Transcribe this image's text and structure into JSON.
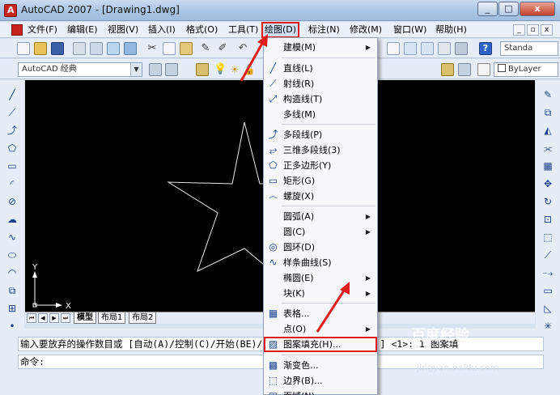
{
  "window": {
    "title": "AutoCAD 2007 - [Drawing1.dwg]",
    "minimize": "_",
    "maximize": "□",
    "close": "x"
  },
  "menubar": {
    "items": [
      "文件(F)",
      "编辑(E)",
      "视图(V)",
      "插入(I)",
      "格式(O)",
      "工具(T)",
      "绘图(D)",
      "标注(N)",
      "修改(M)",
      "窗口(W)",
      "帮助(H)"
    ],
    "active": "绘图(D)",
    "mdi_min": "_",
    "mdi_restore": "▫",
    "mdi_close": "x"
  },
  "toolbar": {
    "style_combo": "Standa",
    "workspace_combo": "AutoCAD 经典",
    "linetype_combo": "ByLayer"
  },
  "drawing": {
    "model_tab": "模型",
    "layout1_tab": "布局1",
    "layout2_tab": "布局2",
    "ucs_y": "Y",
    "ucs_x": "X"
  },
  "dropdown": {
    "items": [
      {
        "label": "建模(M)",
        "icon": "none",
        "submenu": true
      },
      {
        "label": "直线(L)",
        "icon": "line-icon",
        "submenu": false
      },
      {
        "label": "射线(R)",
        "icon": "ray-icon",
        "submenu": false
      },
      {
        "label": "构造线(T)",
        "icon": "xline-icon",
        "submenu": false
      },
      {
        "label": "多线(M)",
        "icon": "none",
        "submenu": false
      },
      {
        "label": "多段线(P)",
        "icon": "polyline-icon",
        "submenu": false
      },
      {
        "label": "三维多段线(3)",
        "icon": "3dpoly-icon",
        "submenu": false
      },
      {
        "label": "正多边形(Y)",
        "icon": "polygon-icon",
        "submenu": false
      },
      {
        "label": "矩形(G)",
        "icon": "rectangle-icon",
        "submenu": false
      },
      {
        "label": "螺旋(X)",
        "icon": "helix-icon",
        "submenu": false
      },
      {
        "label": "圆弧(A)",
        "icon": "none",
        "submenu": true
      },
      {
        "label": "圆(C)",
        "icon": "none",
        "submenu": true
      },
      {
        "label": "圆环(D)",
        "icon": "donut-icon",
        "submenu": false
      },
      {
        "label": "样条曲线(S)",
        "icon": "spline-icon",
        "submenu": false
      },
      {
        "label": "椭圆(E)",
        "icon": "none",
        "submenu": true
      },
      {
        "label": "块(K)",
        "icon": "none",
        "submenu": true
      },
      {
        "label": "表格...",
        "icon": "table-icon",
        "submenu": false
      },
      {
        "label": "点(O)",
        "icon": "none",
        "submenu": true
      },
      {
        "label": "图案填充(H)...",
        "icon": "hatch-icon",
        "submenu": false
      },
      {
        "label": "渐变色...",
        "icon": "gradient-icon",
        "submenu": false
      },
      {
        "label": "边界(B)...",
        "icon": "boundary-icon",
        "submenu": false
      },
      {
        "label": "面域(N)",
        "icon": "region-icon",
        "submenu": false
      }
    ]
  },
  "command": {
    "line1": "输入要放弃的操作数目或 [自动(A)/控制(C)/开始(BE)/结束(E)/标记(M)/后退(B)] <1>: 1 图案填",
    "line2": "命令:"
  },
  "watermark": {
    "text": "百度经验",
    "url": "jingyan.baidu.com"
  },
  "colors": {
    "highlight_border": "#e01d1d",
    "canvas_bg": "#000000",
    "menu_bg": "#f6f7f9"
  }
}
